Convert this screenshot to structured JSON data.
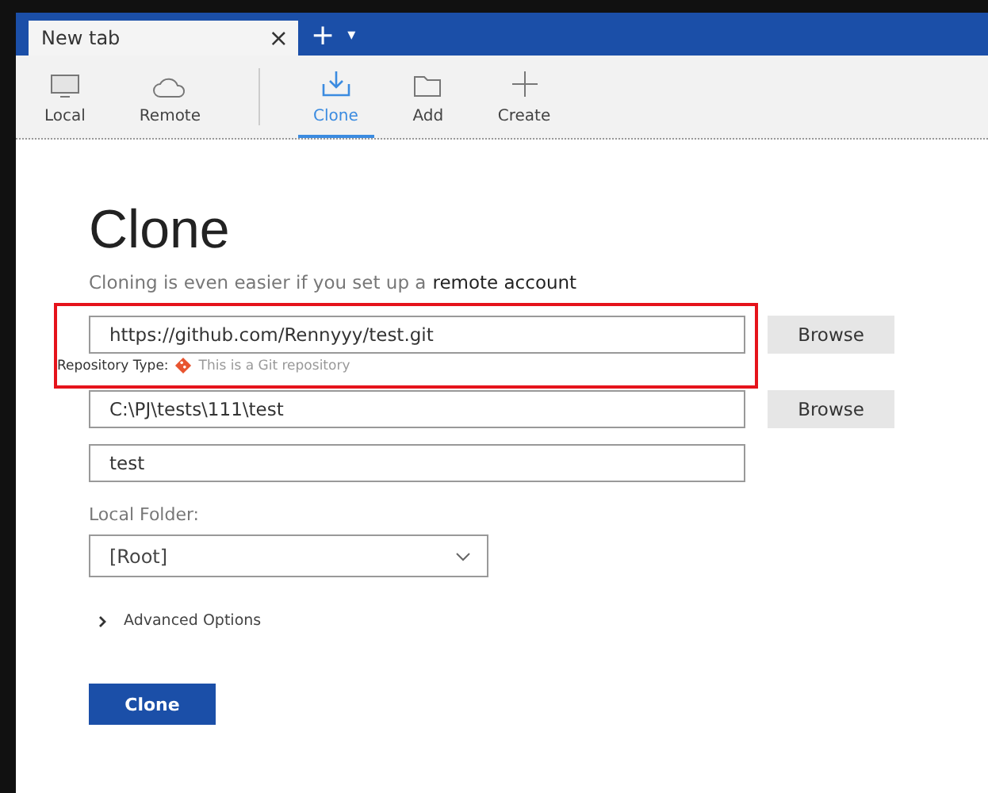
{
  "tab": {
    "title": "New tab",
    "close": "×",
    "new": "+",
    "menu": "▾"
  },
  "toolbar": {
    "items": [
      {
        "label": "Local",
        "kind": "monitor",
        "selected": false
      },
      {
        "label": "Remote",
        "kind": "cloud",
        "selected": false
      },
      {
        "label": "Clone",
        "kind": "clone",
        "selected": true
      },
      {
        "label": "Add",
        "kind": "folder",
        "selected": false
      },
      {
        "label": "Create",
        "kind": "plus",
        "selected": false
      }
    ]
  },
  "heading": "Clone",
  "subtitle": {
    "text": "Cloning is even easier if you set up a",
    "link": "remote account"
  },
  "source": {
    "value": "https://github.com/Rennyyy/test.git",
    "button": "Browse",
    "type_label": "Repository Type:",
    "type_text": "This is a Git repository"
  },
  "destination": {
    "value": "C:\\PJ\\tests\\111\\test",
    "button": "Browse"
  },
  "name": {
    "value": "test"
  },
  "local_folder": {
    "label": "Local Folder:",
    "value": "[Root]"
  },
  "advanced": {
    "label": "Advanced Options",
    "expanded": false
  },
  "clone_button": "Clone"
}
